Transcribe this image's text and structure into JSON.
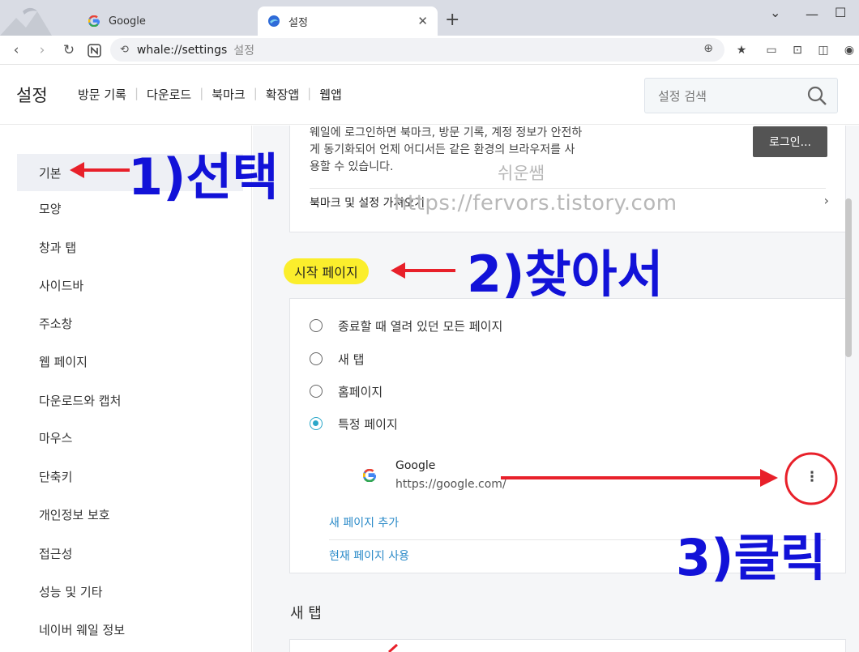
{
  "browser": {
    "tabs": [
      {
        "label": "Google",
        "icon": "google-g-icon",
        "active": false
      },
      {
        "label": "설정",
        "icon": "whale-icon",
        "active": true
      }
    ],
    "address": {
      "url": "whale://settings",
      "page_title": "설정"
    }
  },
  "settings": {
    "title": "설정",
    "nav": [
      "방문 기록",
      "다운로드",
      "북마크",
      "확장앱",
      "웹앱"
    ],
    "search_placeholder": "설정 검색"
  },
  "sidebar": {
    "items": [
      "기본",
      "모양",
      "창과 탭",
      "사이드바",
      "주소창",
      "웹 페이지",
      "다운로드와 캡처",
      "마우스",
      "단축키",
      "개인정보 보호",
      "접근성",
      "성능 및 기타",
      "네이버 웨일 정보"
    ],
    "active_index": 0
  },
  "main": {
    "login_text": "웨일에 로그인하면 북마크, 방문 기록, 계정 정보가 안전하게 동기화되어 언제 어디서든 같은 환경의 브라우저를 사용할 수 있습니다.",
    "login_button": "로그인...",
    "bookmark_import": "북마크 및 설정 가져오기",
    "start_page": {
      "title": "시작 페이지",
      "options": [
        "종료할 때 열려 있던 모든 페이지",
        "새 탭",
        "홈페이지",
        "특정 페이지"
      ],
      "selected_index": 3,
      "site": {
        "name": "Google",
        "url": "https://google.com/"
      },
      "add_link": "새 페이지 추가",
      "current_link": "현재 페이지 사용"
    },
    "new_tab_title": "새 탭"
  },
  "annotations": {
    "step1": "1)선택",
    "step2": "2)찾아서",
    "step3": "3)클릭",
    "arrow_color": "#e8202a",
    "text_color": "#1212d8",
    "highlight_color": "#fbee2c"
  },
  "watermark": {
    "line1": "쉬운쌤",
    "line2": "https://fervors.tistory.com"
  },
  "colors": {
    "accent": "#2aa7c9",
    "link": "#2a8ac8",
    "login_button": "#545454"
  }
}
